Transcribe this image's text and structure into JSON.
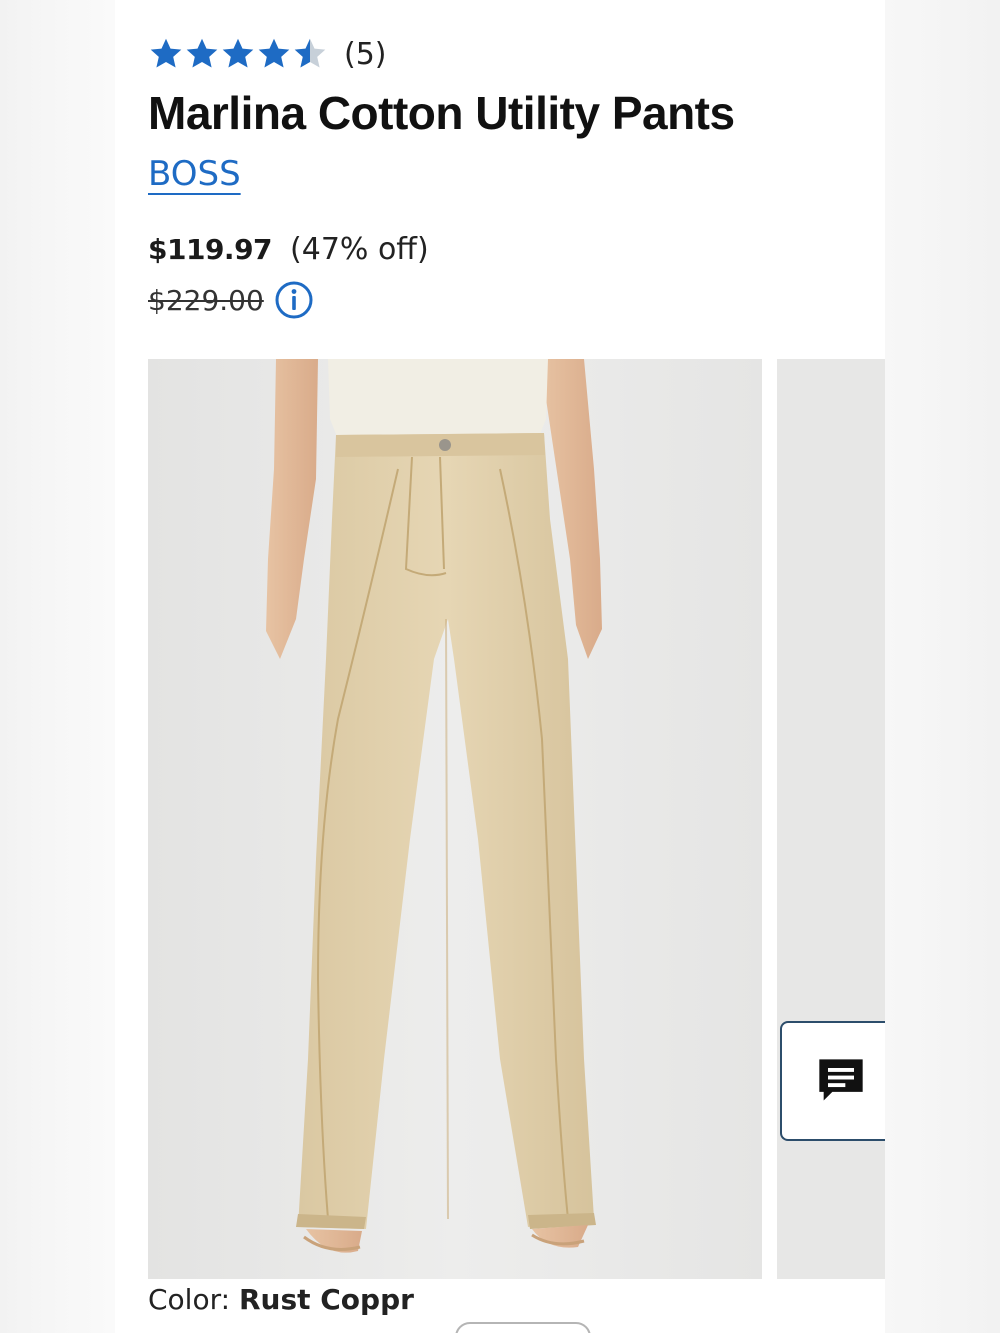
{
  "rating": {
    "stars_filled": 4.5,
    "stars_total": 5,
    "count_label": "(5)",
    "star_color": "#1e6bc4",
    "star_empty_color": "#c7d0d9"
  },
  "product": {
    "title": "Marlina Cotton Utility Pants",
    "brand": "BOSS",
    "brand_color": "#1e6bc4"
  },
  "pricing": {
    "sale_price": "$119.97",
    "discount": "(47% off)",
    "original_price": "$229.00"
  },
  "gallery": {
    "main_image": "product-photo",
    "next_image": "product-photo-next"
  },
  "chat": {
    "icon": "chat-icon"
  },
  "color": {
    "label": "Color: ",
    "value": "Rust Coppr"
  }
}
